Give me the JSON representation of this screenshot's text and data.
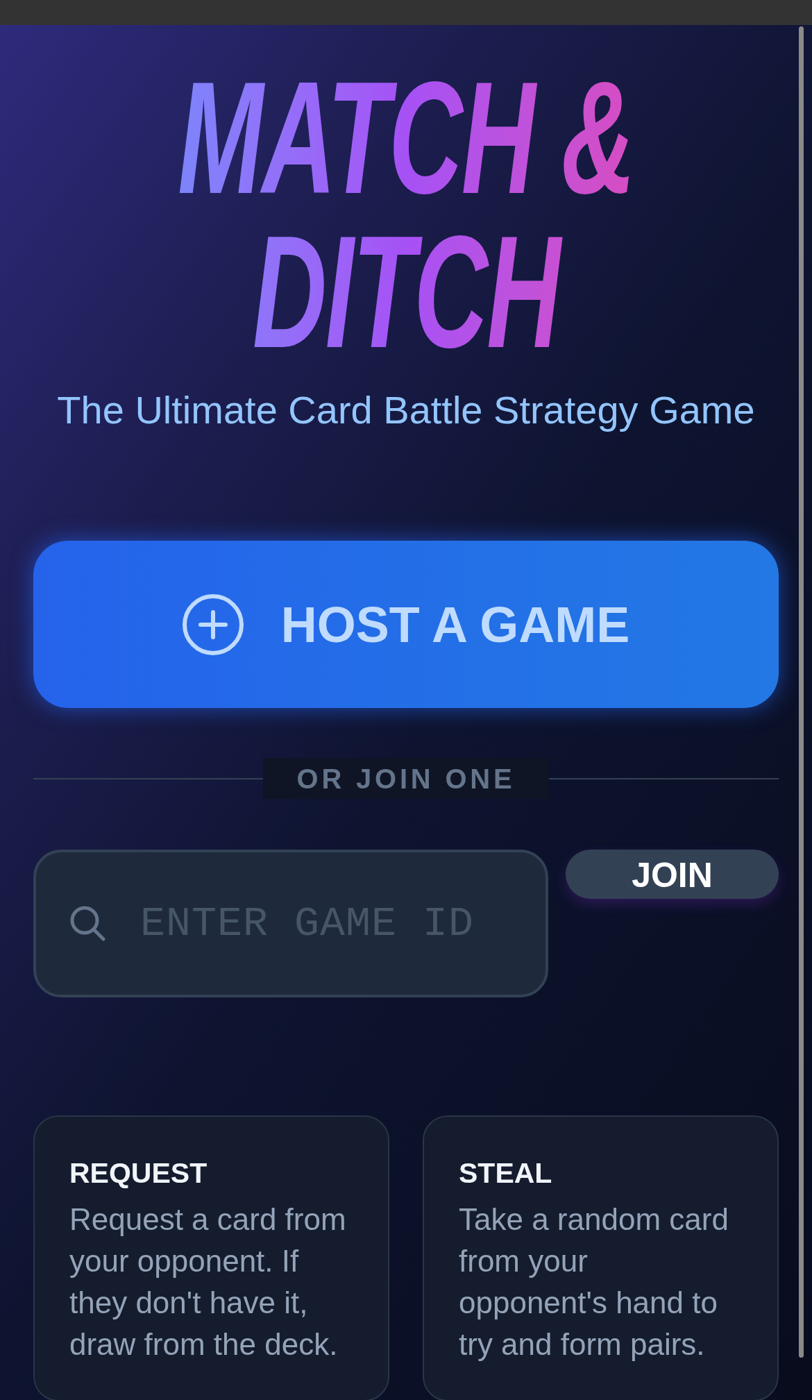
{
  "title": "MATCH & DITCH",
  "subtitle": "The Ultimate Card Battle Strategy Game",
  "host_button": {
    "label": "HOST A GAME"
  },
  "divider": {
    "label": "OR JOIN ONE"
  },
  "join": {
    "field": {
      "placeholder": "ENTER GAME ID"
    },
    "button": {
      "label": "JOIN"
    }
  },
  "cards": [
    {
      "title": "REQUEST",
      "description": "Request a card from your opponent. If they don't have it, draw from the deck."
    },
    {
      "title": "STEAL",
      "description": "Take a random card from your opponent's hand to try and form pairs."
    }
  ]
}
